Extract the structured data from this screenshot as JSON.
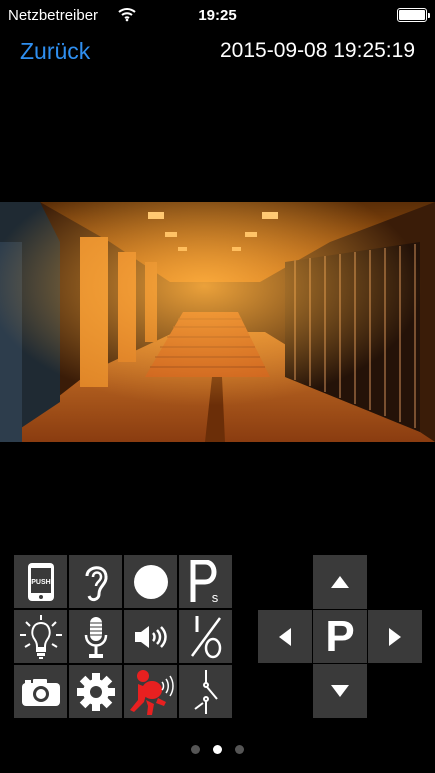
{
  "status_bar": {
    "carrier": "Netzbetreiber",
    "time": "19:25",
    "wifi_icon": "wifi-icon",
    "battery_icon": "battery-icon"
  },
  "nav": {
    "back_label": "Zurück",
    "timestamp": "2015-09-08 19:25:19",
    "accent_color": "#2f8ff0"
  },
  "camera": {
    "feed_icon": "camera-live-image"
  },
  "controls": {
    "push_label": "PUSH",
    "items": [
      "push-phone-icon",
      "ear-listen-icon",
      "record-icon",
      "parking-s-icon",
      "light-bulb-icon",
      "microphone-icon",
      "speaker-icon",
      "switch-io-icon",
      "snapshot-camera-icon",
      "settings-gear-icon",
      "burglar-alarm-icon",
      "relay-switch-icon"
    ],
    "alarm_color": "#e82020"
  },
  "ptz": {
    "center_label": "P",
    "icons": [
      "arrow-up-icon",
      "arrow-left-icon",
      "arrow-right-icon",
      "arrow-down-icon"
    ]
  },
  "pager": {
    "pages": 3,
    "current": 2
  }
}
